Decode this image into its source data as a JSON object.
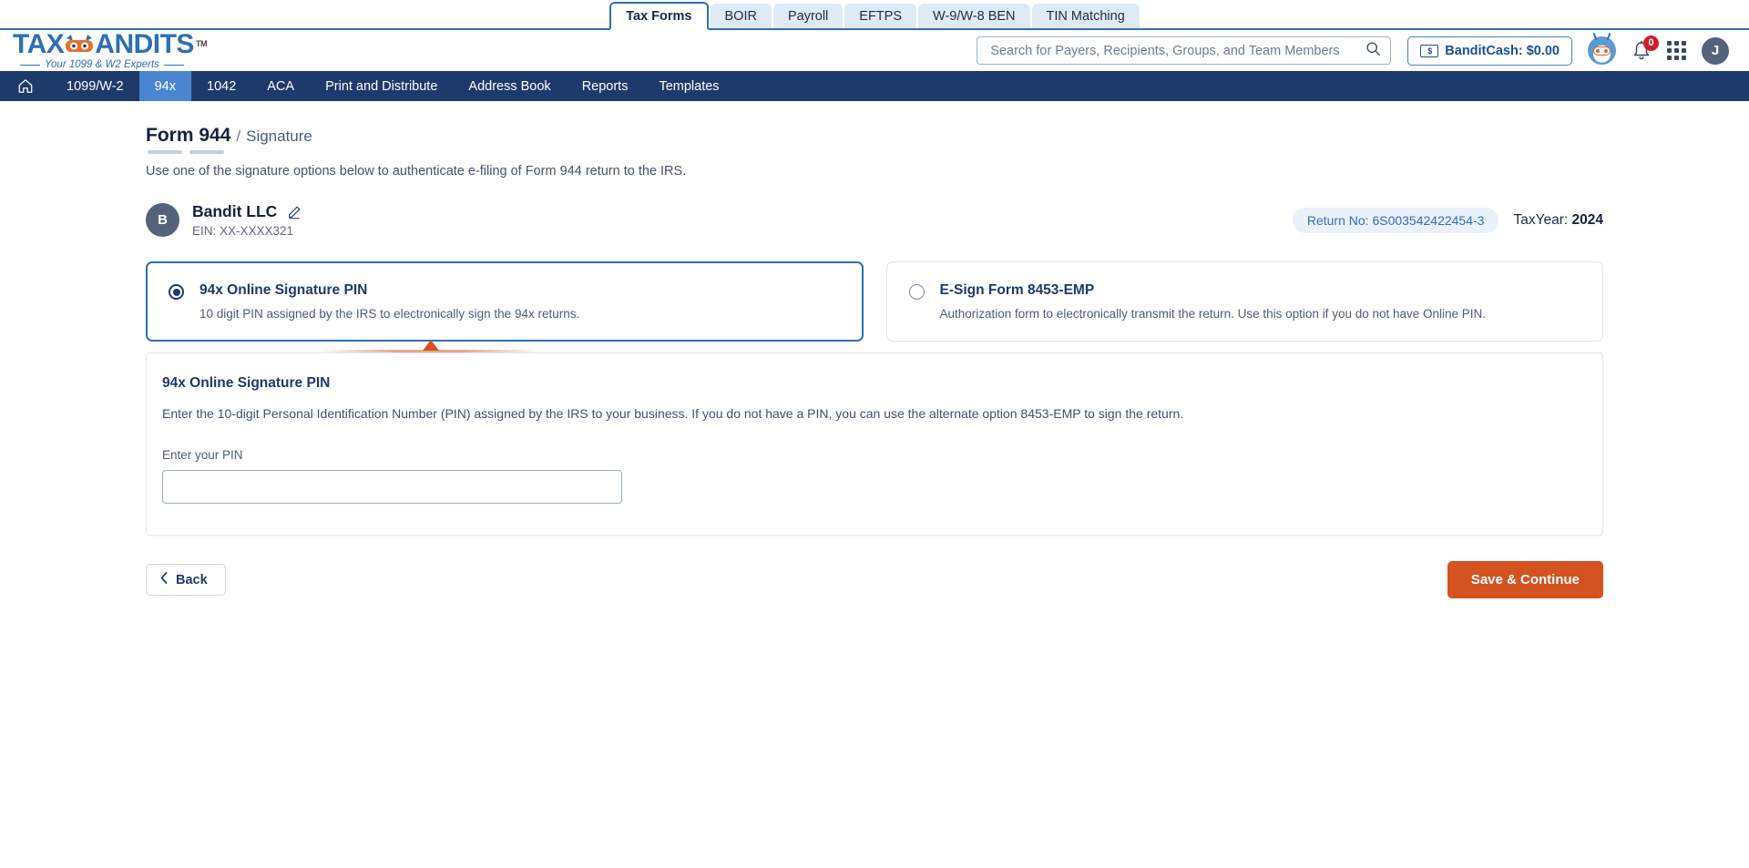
{
  "top_tabs": [
    {
      "label": "Tax Forms",
      "active": true
    },
    {
      "label": "BOIR",
      "active": false
    },
    {
      "label": "Payroll",
      "active": false
    },
    {
      "label": "EFTPS",
      "active": false
    },
    {
      "label": "W-9/W-8 BEN",
      "active": false
    },
    {
      "label": "TIN Matching",
      "active": false
    }
  ],
  "brand": {
    "name_part1": "TAX",
    "name_part2": "ANDITS",
    "trademark": "TM",
    "tagline": "Your 1099 & W2 Experts"
  },
  "search": {
    "placeholder": "Search for Payers, Recipients, Groups, and Team Members",
    "value": ""
  },
  "header": {
    "bandit_cash_label": "BanditCash: $0.00",
    "bandit_cash_icon_text": "$",
    "notification_count": "0",
    "avatar_initial": "J"
  },
  "main_nav": [
    {
      "label": "",
      "icon": "home-icon",
      "active": false
    },
    {
      "label": "1099/W-2",
      "active": false
    },
    {
      "label": "94x",
      "active": true
    },
    {
      "label": "1042",
      "active": false
    },
    {
      "label": "ACA",
      "active": false
    },
    {
      "label": "Print and Distribute",
      "active": false
    },
    {
      "label": "Address Book",
      "active": false
    },
    {
      "label": "Reports",
      "active": false
    },
    {
      "label": "Templates",
      "active": false
    }
  ],
  "page": {
    "title": "Form 944",
    "separator": "/",
    "subtitle": "Signature",
    "description": "Use one of the signature options below to authenticate e-filing of Form 944 return to the IRS."
  },
  "business": {
    "avatar_initial": "B",
    "name": "Bandit LLC",
    "ein": "EIN: XX-XXXX321",
    "return_no": "Return No: 6S003542422454-3",
    "tax_year_label": "TaxYear:",
    "tax_year_value": "2024"
  },
  "options": [
    {
      "title": "94x Online Signature PIN",
      "description": "10 digit PIN assigned by the IRS to electronically sign the 94x returns.",
      "selected": true
    },
    {
      "title": "E-Sign Form 8453-EMP",
      "description": "Authorization form to electronically transmit the return. Use this option if you do not have Online PIN.",
      "selected": false
    }
  ],
  "pin_panel": {
    "title": "94x Online Signature PIN",
    "description": "Enter the 10-digit Personal Identification Number (PIN) assigned by the IRS to your business. If you do not have a PIN, you can use the alternate option 8453-EMP to sign the return.",
    "field_label": "Enter your PIN",
    "field_value": "",
    "field_placeholder": ""
  },
  "footer": {
    "back_label": "Back",
    "save_label": "Save & Continue"
  },
  "colors": {
    "accent_orange": "#d4521f",
    "nav_navy": "#1e3a6b",
    "brand_blue": "#2f6eb5",
    "badge_red": "#d01f2b"
  }
}
